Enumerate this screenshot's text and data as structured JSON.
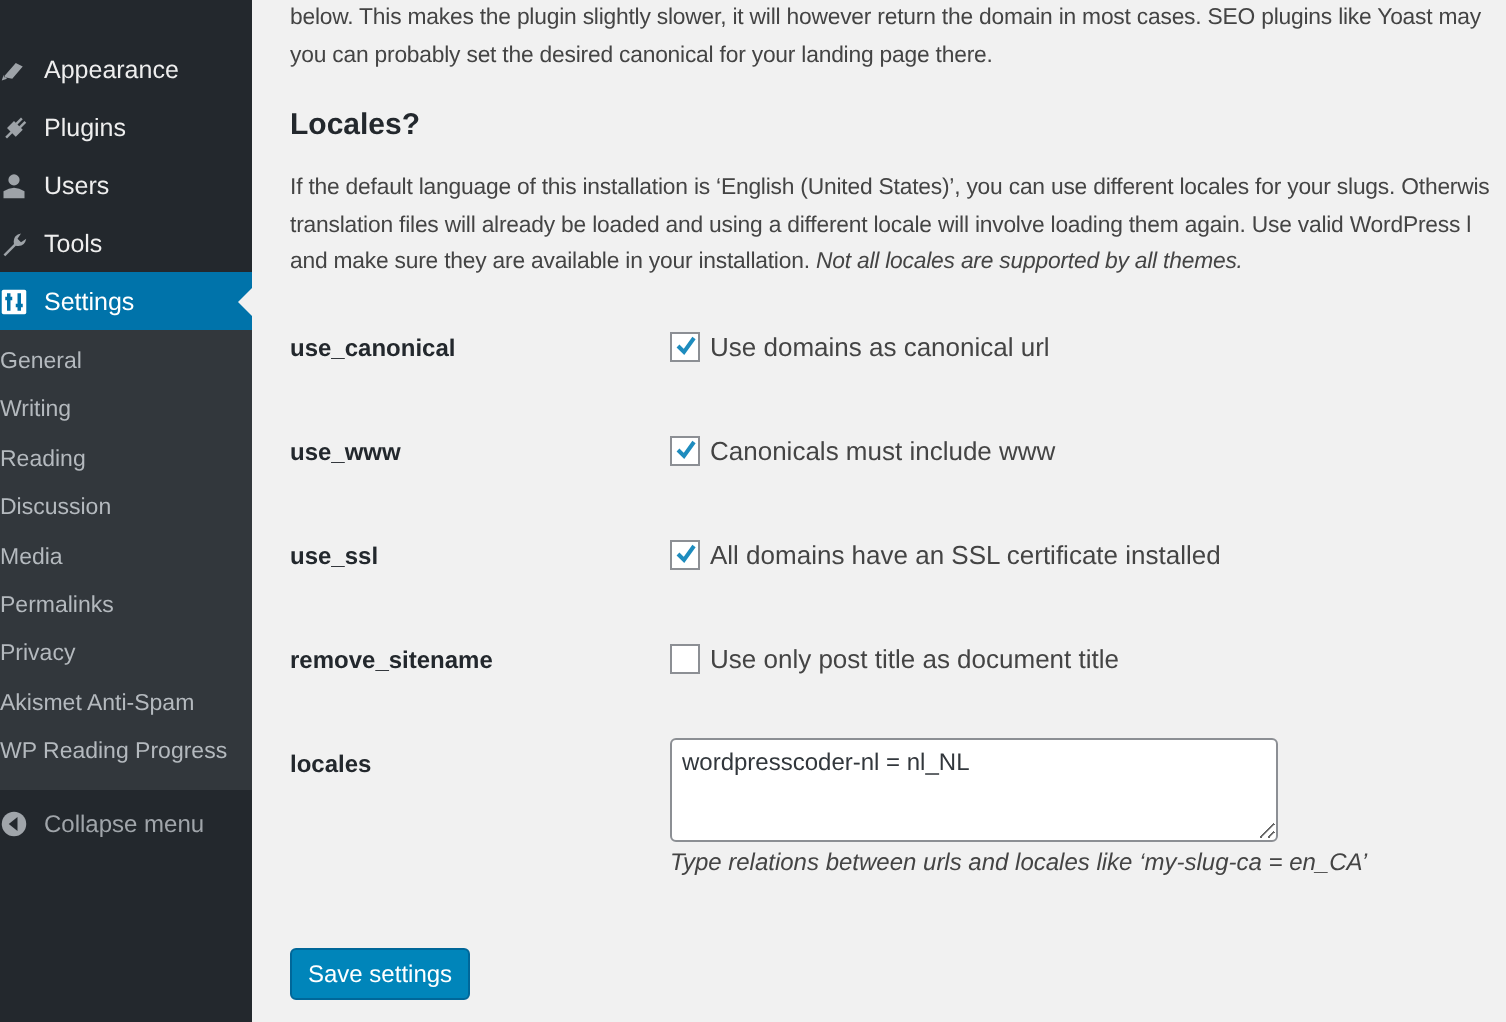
{
  "sidebar": {
    "items": [
      {
        "label": "Appearance",
        "selected": false
      },
      {
        "label": "Plugins",
        "selected": false
      },
      {
        "label": "Users",
        "selected": false
      },
      {
        "label": "Tools",
        "selected": false
      },
      {
        "label": "Settings",
        "selected": true
      }
    ],
    "submenu": [
      "General",
      "Writing",
      "Reading",
      "Discussion",
      "Media",
      "Permalinks",
      "Privacy",
      "Akismet Anti-Spam",
      "WP Reading Progress"
    ],
    "collapse": "Collapse menu"
  },
  "intro_lines": [
    "below. This makes the plugin slightly slower, it will however return the domain in most cases. SEO plugins like Yoast may",
    "you can probably set the desired canonical for your landing page there."
  ],
  "heading": "Locales?",
  "description_lines": [
    "If the default language of this installation is ‘English (United States)’, you can use different locales for your slugs. Otherwis",
    "translation files will already be loaded and using a different locale will involve loading them again. Use valid WordPress l",
    "and make sure they are available in your installation. *Not all locales are supported by all themes.*"
  ],
  "fields": [
    {
      "kind": "checkbox",
      "name": "use_canonical",
      "label": "Use domains as canonical url",
      "checked": true
    },
    {
      "kind": "checkbox",
      "name": "use_www",
      "label": "Canonicals must include www",
      "checked": true
    },
    {
      "kind": "checkbox",
      "name": "use_ssl",
      "label": "All domains have an SSL certificate installed",
      "checked": true
    },
    {
      "kind": "checkbox",
      "name": "remove_sitename",
      "label": "Use only post title as document title",
      "checked": false
    },
    {
      "kind": "textarea",
      "name": "locales",
      "value": "wordpresscoder-nl = nl_NL",
      "hint": "Type relations between urls and locales like ‘my-slug-ca = en_CA’"
    }
  ],
  "save_button": "Save settings"
}
